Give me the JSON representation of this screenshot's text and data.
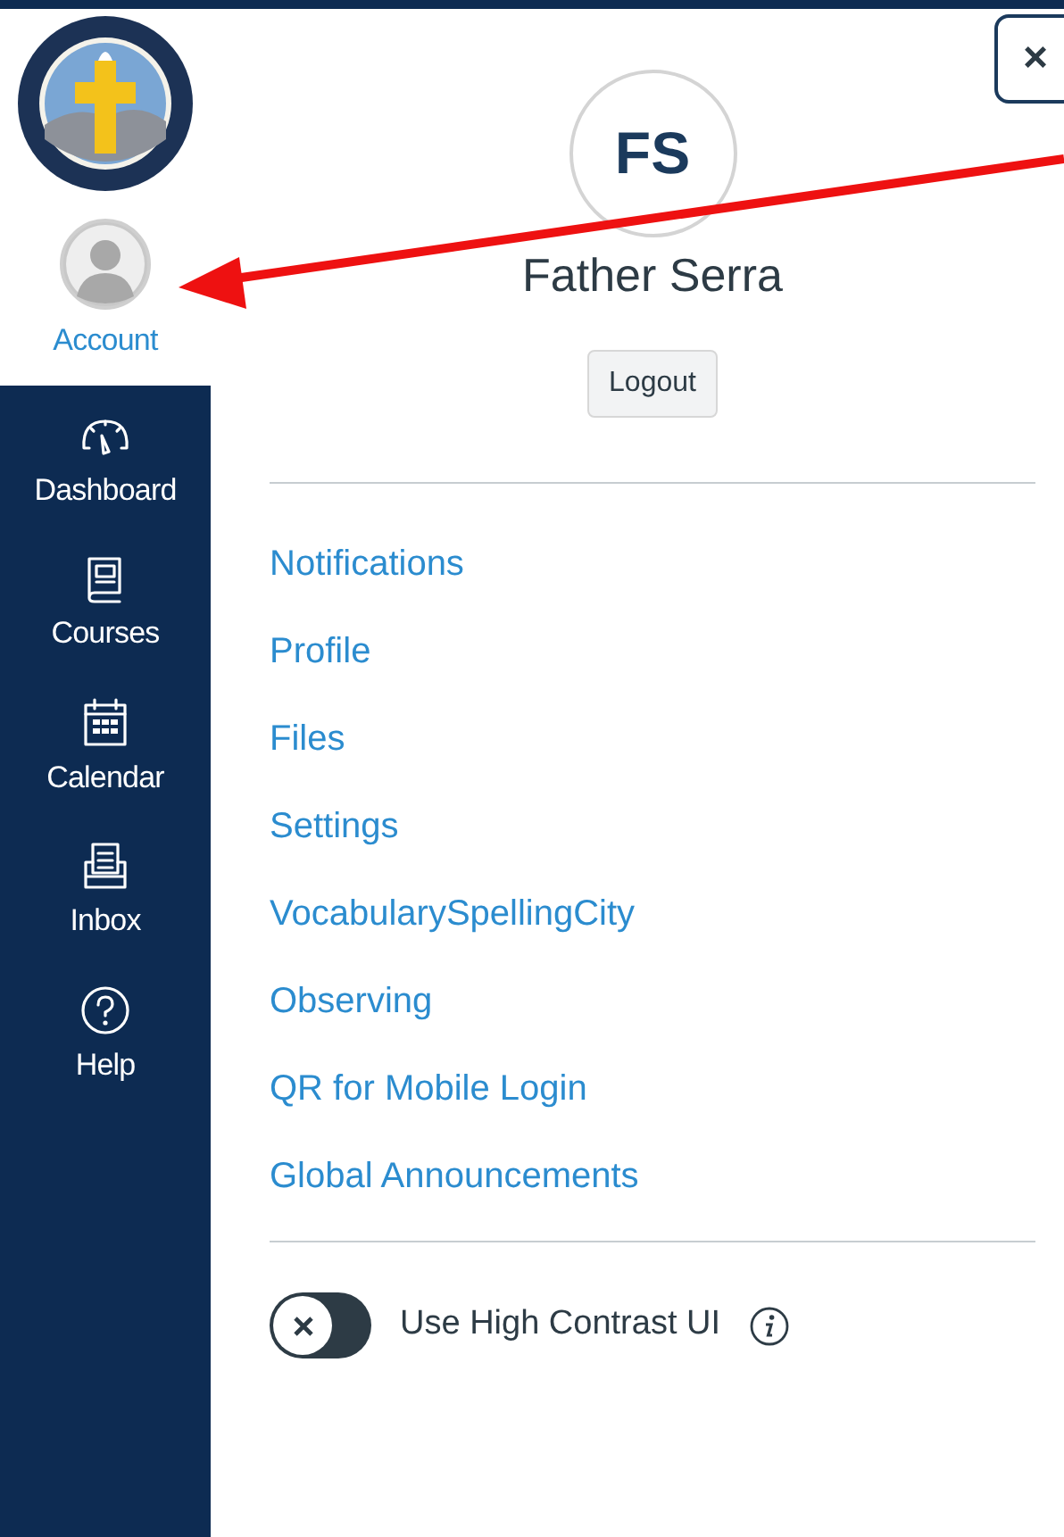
{
  "sidebar": {
    "items": [
      {
        "label": "Account",
        "kind": "account",
        "selected": true
      },
      {
        "label": "Dashboard",
        "kind": "dashboard",
        "selected": false
      },
      {
        "label": "Courses",
        "kind": "courses",
        "selected": false
      },
      {
        "label": "Calendar",
        "kind": "calendar",
        "selected": false
      },
      {
        "label": "Inbox",
        "kind": "inbox",
        "selected": false
      },
      {
        "label": "Help",
        "kind": "help",
        "selected": false
      }
    ]
  },
  "close_button": {
    "label": "×"
  },
  "profile": {
    "initials": "FS",
    "name": "Father Serra",
    "logout": "Logout"
  },
  "links": [
    "Notifications",
    "Profile",
    "Files",
    "Settings",
    "VocabularySpellingCity",
    "Observing",
    "QR for Mobile Login",
    "Global Announcements"
  ],
  "high_contrast": {
    "label": "Use High Contrast UI",
    "on": false
  }
}
